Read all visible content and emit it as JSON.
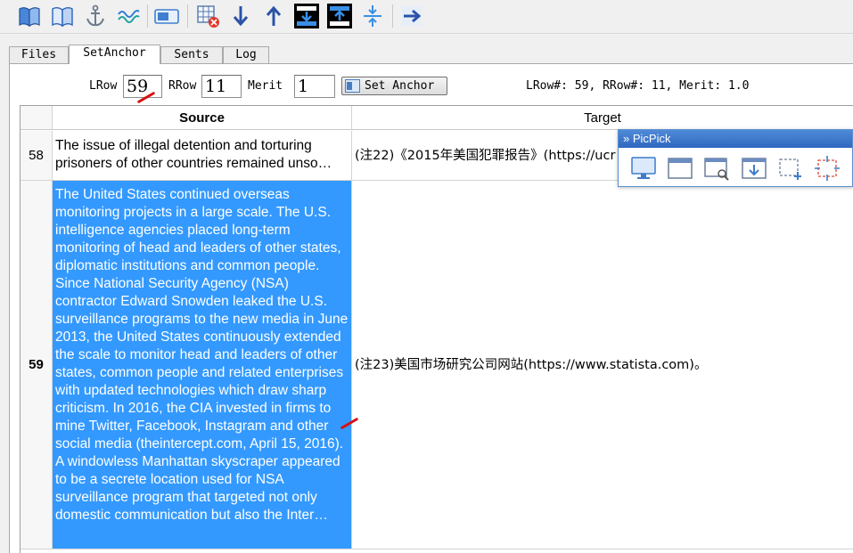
{
  "toolbar": {
    "buttons": [
      {
        "name": "open-book-blue",
        "icon": "book-icon"
      },
      {
        "name": "open-book-outline",
        "icon": "book-outline-icon"
      },
      {
        "name": "anchor",
        "icon": "anchor-icon"
      },
      {
        "name": "wave-link",
        "icon": "wave-icon"
      },
      {
        "name": "toggle-panel",
        "icon": "panel-icon"
      },
      {
        "name": "delete-grid",
        "icon": "grid-delete-icon"
      },
      {
        "name": "move-down",
        "icon": "arrow-down-icon"
      },
      {
        "name": "move-up",
        "icon": "arrow-up-icon"
      },
      {
        "name": "merge-down",
        "icon": "merge-down-icon"
      },
      {
        "name": "merge-up",
        "icon": "merge-up-icon"
      },
      {
        "name": "split",
        "icon": "split-vertical-icon"
      },
      {
        "name": "export",
        "icon": "arrow-right-icon"
      }
    ]
  },
  "tabs": [
    {
      "label": "Files",
      "active": false
    },
    {
      "label": "SetAnchor",
      "active": true
    },
    {
      "label": "Sents",
      "active": false
    },
    {
      "label": "Log",
      "active": false
    }
  ],
  "anchor": {
    "lrow_label": "LRow",
    "lrow_value": "59",
    "rrow_label": "RRow",
    "rrow_value": "11",
    "merit_label": "Merit",
    "merit_value": "1",
    "set_anchor_label": "Set Anchor",
    "status": "LRow#: 59, RRow#: 11, Merit: 1.0"
  },
  "table": {
    "columns": [
      "Source",
      "Target"
    ],
    "rows": [
      {
        "num": "58",
        "source": "The issue of illegal detention and torturing prisoners of other countries remained unso…",
        "target": "(注22)《2015年美国犯罪报告》(https://ucr"
      },
      {
        "num": "59",
        "source": "The United States continued overseas monitoring projects in a large scale. The U.S. intelligence agencies placed long-term monitoring of head and leaders of other states, diplomatic institutions and common people. Since National Security Agency (NSA) contractor Edward Snowden leaked the U.S. surveillance programs to the new media in June 2013, the United States continuously extended the scale to monitor head and leaders of other states, common people and related enterprises with updated technologies which draw sharp criticism. In 2016, the CIA invested in firms to mine Twitter, Facebook, Instagram and other social media (theintercept.com, April 15, 2016). A windowless Manhattan skyscraper appeared to be a secrete location used for NSA surveillance program that targeted not only domestic communication but also the Inter…",
        "target": "(注23)美国市场研究公司网站(https://www.statista.com)。"
      }
    ],
    "selected_color": "#3399ff"
  },
  "picpick": {
    "title": "» PicPick",
    "tools": [
      "monitor-icon",
      "window-icon",
      "scroll-capture-icon",
      "download-capture-icon",
      "region-add-icon",
      "fixed-region-icon"
    ]
  }
}
